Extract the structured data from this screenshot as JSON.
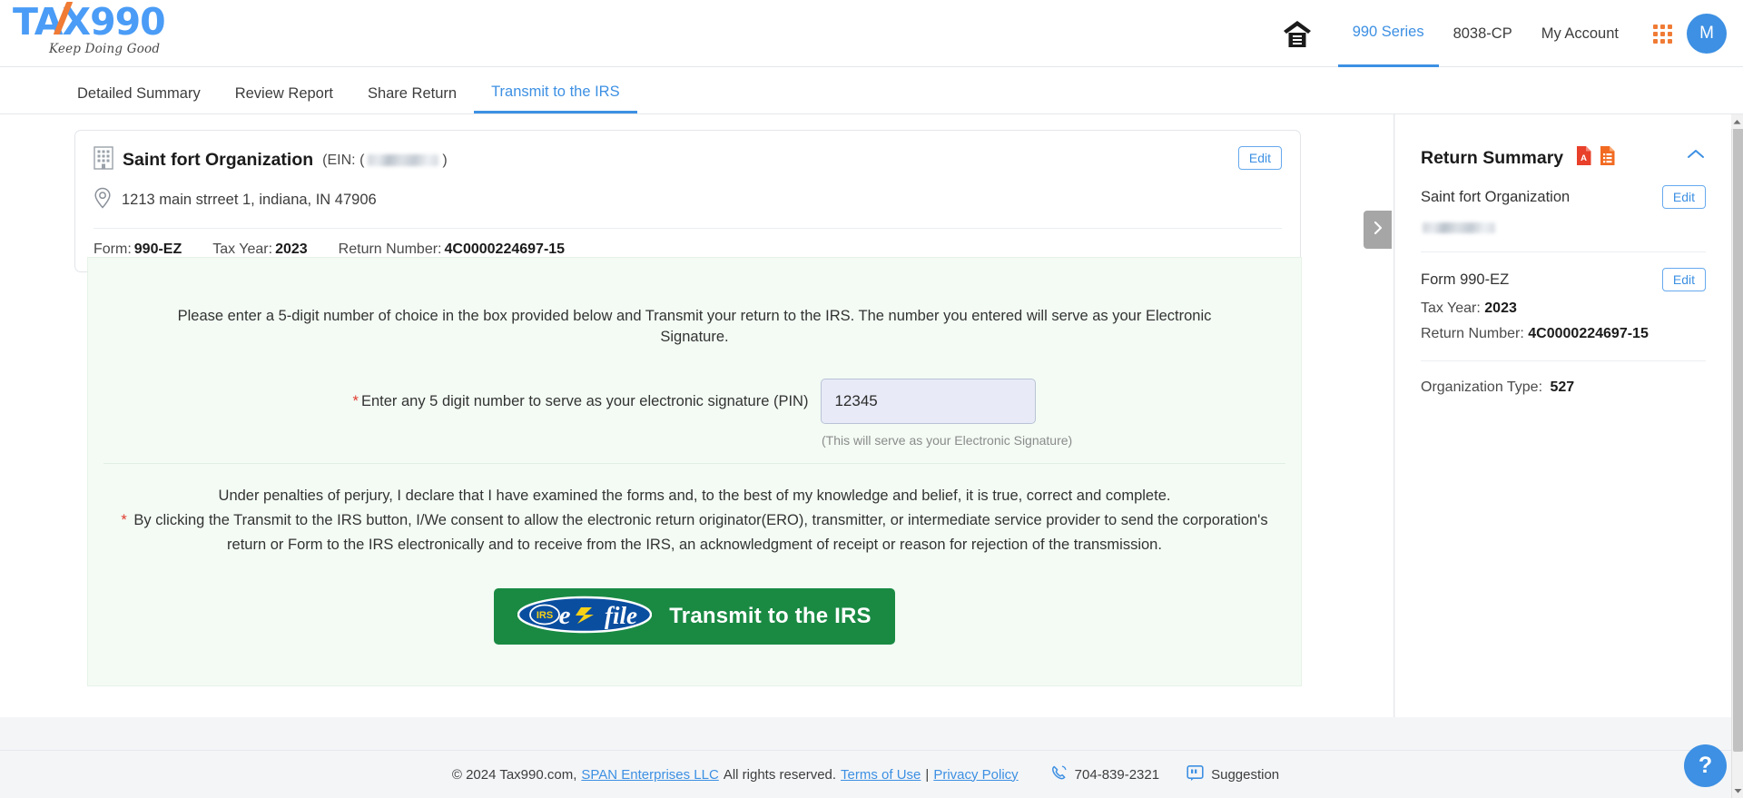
{
  "brand": {
    "logo_text_1": "TA",
    "logo_text_2": "X990",
    "tagline": "Keep Doing Good",
    "accent_blue": "#3d90e3",
    "accent_orange": "#f07b35",
    "efile_green": "#1a8a43"
  },
  "header": {
    "home_icon": "home-icon",
    "nav": [
      {
        "label": "990 Series",
        "active": true
      },
      {
        "label": "8038-CP",
        "active": false
      },
      {
        "label": "My Account",
        "active": false
      }
    ],
    "apps_icon": "grid-apps-icon",
    "avatar_initial": "M"
  },
  "tabs": [
    {
      "label": "Detailed Summary",
      "active": false
    },
    {
      "label": "Review Report",
      "active": false
    },
    {
      "label": "Share Return",
      "active": false
    },
    {
      "label": "Transmit to the IRS",
      "active": true
    }
  ],
  "org_card": {
    "building_icon": "building-icon",
    "name": "Saint fort Organization",
    "ein_prefix": "(EIN: (",
    "ein_suffix": ")",
    "ein_value": "",
    "location_icon": "map-pin-icon",
    "address": "1213 main strreet 1, indiana, IN 47906",
    "form_label": "Form:",
    "form_value": "990-EZ",
    "tax_year_label": "Tax Year:",
    "tax_year_value": "2023",
    "return_number_label": "Return Number:",
    "return_number_value": "4C0000224697-15",
    "edit_label": "Edit"
  },
  "consent": {
    "instruction": "Please enter a 5-digit number of choice in the box provided below and Transmit your return to the IRS. The number you entered will serve as your Electronic Signature.",
    "pin_required_mark": "*",
    "pin_label": "Enter any 5 digit number to serve as your electronic signature (PIN)",
    "pin_value": "12345",
    "pin_placeholder": "",
    "pin_hint": "(This will serve as your Electronic Signature)",
    "perjury_line": "Under penalties of perjury, I declare that I have examined the forms and, to the best of my knowledge and belief, it is true, correct and complete.",
    "consent_required_mark": "*",
    "consent_line": "By clicking the Transmit to the IRS button, I/We consent to allow the electronic return originator(ERO), transmitter, or intermediate service provider to send the corporation's return or Form to the IRS electronically and to receive from the IRS, an acknowledgment of receipt or reason for rejection of the transmission.",
    "submit_label": "Transmit to the IRS",
    "efile_logo_irs": "IRS",
    "efile_logo_e": "e",
    "efile_logo_file": "file"
  },
  "side_toggle_icon": "chevron-right-icon",
  "sidebar": {
    "title": "Return Summary",
    "pdf_icon": "pdf-file-icon",
    "form_icon": "form-list-icon",
    "collapse_icon": "chevron-up-icon",
    "org_name": "Saint fort Organization",
    "org_edit_label": "Edit",
    "form_label": "Form 990-EZ",
    "form_edit_label": "Edit",
    "tax_year_label": "Tax Year:",
    "tax_year_value": "2023",
    "return_number_label": "Return Number:",
    "return_number_value": "4C0000224697-15",
    "org_type_label": "Organization Type:",
    "org_type_value": "527"
  },
  "footer": {
    "copyright": "© 2024 Tax990.com,",
    "company_link": "SPAN Enterprises LLC",
    "rights": "All rights reserved.",
    "terms_link": "Terms of Use",
    "separator": "|",
    "privacy_link": "Privacy Policy",
    "phone_icon": "phone-icon",
    "phone": "704-839-2321",
    "suggestion_icon": "quote-bubble-icon",
    "suggestion_label": "Suggestion"
  },
  "help": {
    "icon": "question-mark-icon",
    "label": "?"
  }
}
